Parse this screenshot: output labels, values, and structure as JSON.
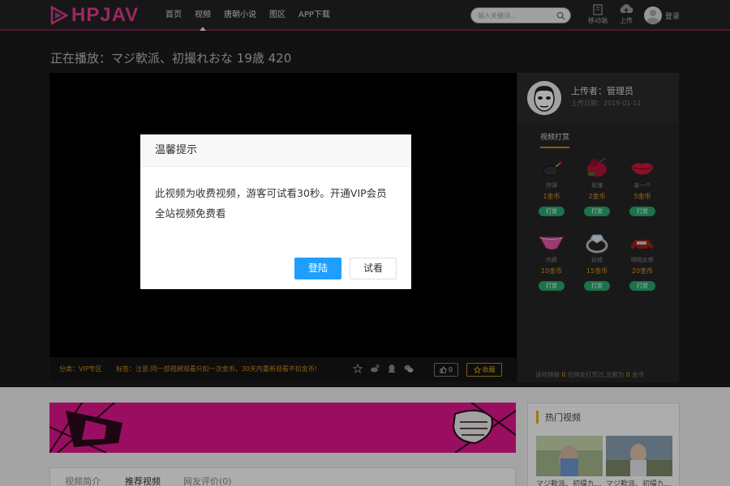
{
  "header": {
    "logo_text": "HPJAV",
    "nav": [
      "首页",
      "视频",
      "唐朝小说",
      "图区",
      "APP下载"
    ],
    "search_placeholder": "输入关键词...",
    "mobile_label": "移动端",
    "upload_label": "上传",
    "login_label": "登录"
  },
  "page": {
    "title": "正在播放：マジ軟派、初撮れおな 19歳 420"
  },
  "video_bar": {
    "category": "分类：VIP专区",
    "tag_label": "标签：",
    "tag_notice": "注意:同一部视频观看只扣一次金币，30天内重新观看不扣金币!",
    "like_count": "0",
    "favorite_label": "收藏"
  },
  "uploader": {
    "name_line": "上传者：管理员",
    "date_line": "上传日期：2019-01-11"
  },
  "tip": {
    "tab_label": "视频打赏",
    "button_label": "打赏",
    "gifts": [
      {
        "name": "炸弹",
        "price": "1金币",
        "icon": "bomb-icon"
      },
      {
        "name": "玫瑰",
        "price": "2金币",
        "icon": "rose-icon"
      },
      {
        "name": "亲一个",
        "price": "5金币",
        "icon": "lips-icon"
      },
      {
        "name": "内裤",
        "price": "10金币",
        "icon": "panties-icon"
      },
      {
        "name": "钻戒",
        "price": "15金币",
        "icon": "ring-icon"
      },
      {
        "name": "啪啪女郎",
        "price": "20金币",
        "icon": "car-icon"
      }
    ],
    "footer_prefix": "该视频被",
    "footer_count1": "0",
    "footer_mid": "位网友打赏过,总额为",
    "footer_count2": "0",
    "footer_suffix": "金币"
  },
  "lower": {
    "tabs": [
      "视频简介",
      "推荐视频",
      "网友评价(0)"
    ],
    "hot_title": "热门视频",
    "hot_captions": [
      "マジ軟派、初撮九...",
      "マジ軟派、初撮九..."
    ]
  },
  "modal": {
    "title": "温馨提示",
    "message": "此视频为收费视频，游客可试看30秒。开通VIP会员全站视频免费看",
    "login_button": "登陆",
    "trial_button": "试看"
  },
  "colors": {
    "brand": "#e33b8a",
    "accent_gold": "#d9a72a",
    "tip_green": "#29a86f",
    "modal_primary": "#1e9fff",
    "banner_magenta": "#e4168f"
  }
}
